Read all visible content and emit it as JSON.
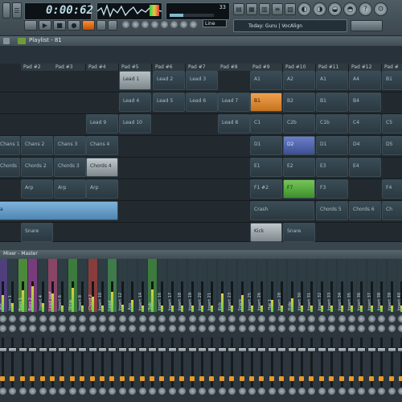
{
  "toolbar": {
    "time": "0:00:62",
    "cpu_text": "33",
    "pattern_number": "Line",
    "hint_text": "Today: Guru | VocAlign"
  },
  "playlist": {
    "title": "Playlist - 81"
  },
  "pads": [
    "Pad #2",
    "Pad #3",
    "Pad #4",
    "Pad #5",
    "Pad #6",
    "Pad #7",
    "Pad #8",
    "Pad #9",
    "Pad #10",
    "Pad #11",
    "Pad #12",
    "Pad #"
  ],
  "clips": {
    "lead1": "Lead 1",
    "lead2": "Lead 2",
    "lead3": "Lead 3",
    "a1": "A1",
    "a2": "A2",
    "a3": "A1",
    "a4": "A4",
    "b1": "B1",
    "lead4": "Lead 4",
    "lead5": "Lead 5",
    "lead6": "Lead 6",
    "lead7": "Lead 7",
    "b1b": "B1",
    "b2": "B2",
    "b3": "B1",
    "b4": "B4",
    "lead9": "Lead 9",
    "lead10": "Lead 10",
    "lead8": "Lead 8",
    "c1": "C1",
    "c2b": "C2b",
    "c1b": "C1b",
    "c4": "C4",
    "c5": "C5",
    "chans1": "Chans 1",
    "chans2": "Chans 2",
    "chans3": "Chans 3",
    "chans4": "Chans 4",
    "d1": "D1",
    "d2": "D2",
    "d3": "D1",
    "d4": "D4",
    "d5": "D5",
    "chords1": "Chords 1",
    "chords2": "Chords 2",
    "chords3": "Chords 3",
    "chords4": "Chords 4",
    "e1": "E1",
    "e2": "E2",
    "e3": "E3",
    "e4": "E4",
    "arp1": "Arp",
    "arp2": "Arp",
    "arp3": "Arp",
    "arp4": "Arp",
    "f1": "F1 #2",
    "f2": "F7",
    "f3": "F3",
    "f4": "F4",
    "blue": "a",
    "crash": "Crash",
    "chords5": "Chords 5",
    "chords6": "Chords 6",
    "chords7": "Ch",
    "snare1": "Snare",
    "kick": "Kick",
    "snare2": "Snare"
  },
  "mixer": {
    "title": "Mixer - Master",
    "tracks": [
      "Vox",
      "Insert 1",
      "Bass 1",
      "Bass 2",
      "Insert 4",
      "Lead pad",
      "Insert 6",
      "Ninja",
      "Insert 8",
      "Chord 2",
      "Insert 10",
      "Lead",
      "Insert 12",
      "Arp",
      "Insert 14",
      "Sub",
      "Insert 16",
      "Insert 17",
      "Insert 18",
      "Insert 19",
      "Insert 20",
      "Insert 21",
      "Kick",
      "Insert 23",
      "Snare",
      "Insert 25",
      "Insert 26",
      "Hat 1",
      "Insert 28",
      "Ride",
      "Insert 30",
      "Insert 31",
      "Insert 32",
      "Insert 33",
      "Insert 34",
      "Insert 35",
      "Insert 36",
      "Insert 37",
      "Insert 38",
      "Insert 39",
      "Insert 40"
    ],
    "colors": [
      "#4f3f7c",
      "#2e3c44",
      "#4b8a3a",
      "#7a3b7c",
      "#2e3c44",
      "#8a4566",
      "#2e3c44",
      "#3d7a3d",
      "#2e3c44",
      "#8a3b3b",
      "#2e3c44",
      "#3e7a4a",
      "#2e3c44",
      "#2e3c44",
      "#2e3c44",
      "#3d7a3d",
      "#2e3c44",
      "#2e3c44",
      "#2e3c44",
      "#2e3c44",
      "#2e3c44",
      "#2e3c44",
      "#2e3c44",
      "#2e3c44",
      "#2e3c44",
      "#2e3c44",
      "#2e3c44",
      "#2e3c44",
      "#2e3c44",
      "#2e3c44",
      "#2e3c44",
      "#2e3c44",
      "#2e3c44",
      "#2e3c44",
      "#2e3c44",
      "#2e3c44",
      "#2e3c44",
      "#2e3c44",
      "#2e3c44",
      "#2e3c44",
      "#2e3c44"
    ],
    "levels": [
      0.55,
      0.3,
      0.7,
      0.85,
      0.3,
      0.6,
      0.2,
      0.8,
      0.2,
      0.5,
      0.2,
      0.65,
      0.25,
      0.4,
      0.2,
      0.75,
      0.2,
      0.2,
      0.2,
      0.2,
      0.2,
      0.2,
      0.6,
      0.2,
      0.55,
      0.2,
      0.2,
      0.4,
      0.2,
      0.45,
      0.2,
      0.2,
      0.2,
      0.2,
      0.2,
      0.2,
      0.2,
      0.2,
      0.2,
      0.2,
      0.2
    ]
  }
}
